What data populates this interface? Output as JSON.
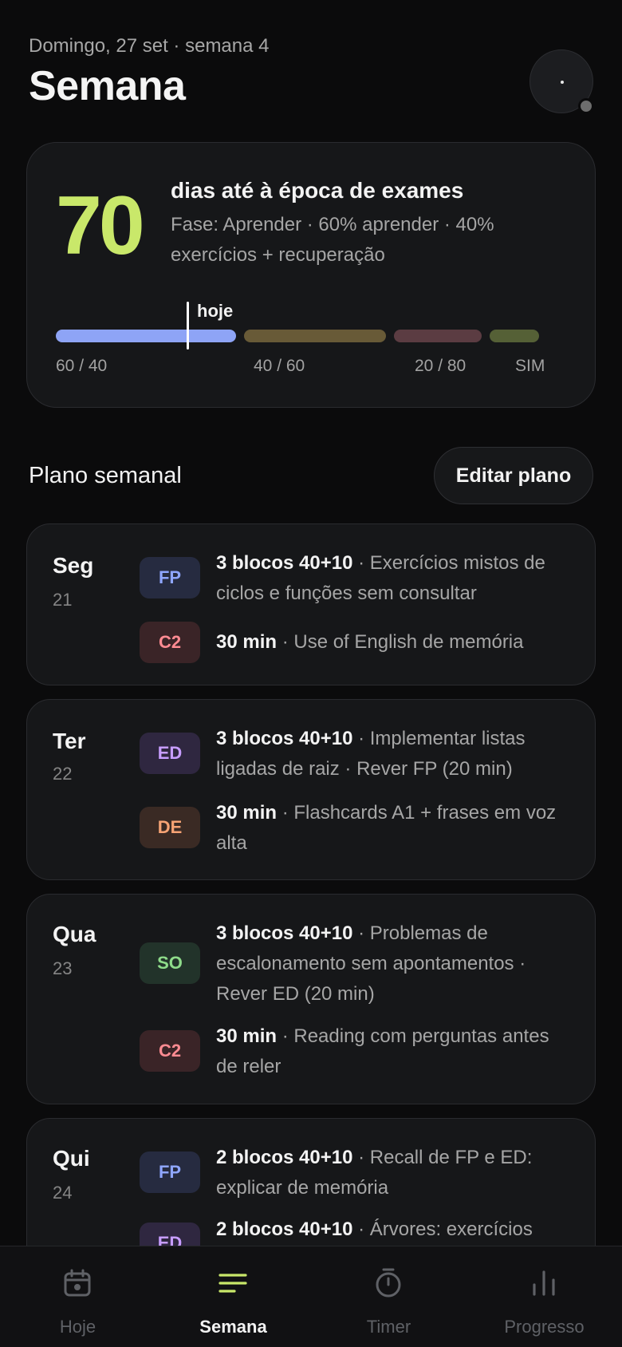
{
  "header": {
    "date_line": "Domingo, 27 set · semana 4",
    "title": "Semana"
  },
  "countdown": {
    "days": "70",
    "title": "dias até à época de exames",
    "subtitle": "Fase: Aprender · 60% aprender · 40% exercícios + recuperação",
    "today_label": "hoje",
    "segments": [
      {
        "label": "60 / 40",
        "color": "#8ea4f6"
      },
      {
        "label": "40 / 60",
        "color": "#685a37"
      },
      {
        "label": "20 / 80",
        "color": "#5b3c42"
      },
      {
        "label": "SIM",
        "color": "#556036"
      }
    ]
  },
  "plan": {
    "title": "Plano semanal",
    "edit_label": "Editar plano"
  },
  "days": [
    {
      "name": "Seg",
      "num": "21",
      "tasks": [
        {
          "badge": "FP",
          "bold": "3 blocos 40+10",
          "rest": " · Exercícios mistos de ciclos e funções sem consultar"
        },
        {
          "badge": "C2",
          "bold": "30 min",
          "rest": " · Use of English de memória"
        }
      ]
    },
    {
      "name": "Ter",
      "num": "22",
      "tasks": [
        {
          "badge": "ED",
          "bold": "3 blocos 40+10",
          "rest": " · Implementar listas ligadas de raiz · Rever FP (20 min)"
        },
        {
          "badge": "DE",
          "bold": "30 min",
          "rest": " · Flashcards A1 + frases em voz alta"
        }
      ]
    },
    {
      "name": "Qua",
      "num": "23",
      "tasks": [
        {
          "badge": "SO",
          "bold": "3 blocos 40+10",
          "rest": " · Problemas de escalonamento sem apontamentos · Rever ED (20 min)"
        },
        {
          "badge": "C2",
          "bold": "30 min",
          "rest": " · Reading com perguntas antes de reler"
        }
      ]
    },
    {
      "name": "Qui",
      "num": "24",
      "tasks": [
        {
          "badge": "FP",
          "bold": "2 blocos 40+10",
          "rest": " · Recall de FP e ED: explicar de memória"
        },
        {
          "badge": "ED",
          "bold": "2 blocos 40+10",
          "rest": " · Árvores: exercícios"
        }
      ]
    }
  ],
  "nav": {
    "items": [
      {
        "label": "Hoje",
        "icon": "calendar-icon"
      },
      {
        "label": "Semana",
        "icon": "list-icon"
      },
      {
        "label": "Timer",
        "icon": "timer-icon"
      },
      {
        "label": "Progresso",
        "icon": "bar-chart-icon"
      }
    ],
    "active_index": 1
  },
  "colors": {
    "accent": "#c9e86a",
    "background": "#0b0b0c",
    "card": "#161719"
  }
}
